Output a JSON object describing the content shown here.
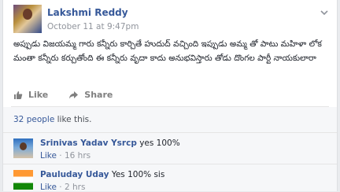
{
  "post": {
    "author": "Lakshmi Reddy",
    "timestamp": "October 11 at 9:47pm",
    "text": "అప్పుడు విజయమ్మ గారు కన్నీరు కార్చితే హుదుద్ వచ్చింది ఇప్పుడు అమ్మ తో పాటు మహిళా లోకమంతా కన్నీరు కర్చుతోంది ఈ కన్నీరు వృదా కాదు అనుభవిస్తారు తోడు దొంగల పార్టీ నాయకులారా",
    "like_label": "Like",
    "share_label": "Share"
  },
  "likes": {
    "count_text": "32 people",
    "suffix": " like this."
  },
  "comments": [
    {
      "author": "Srinivas Yadav Ysrcp",
      "text": " yes 100%",
      "like_label": "Like",
      "time": "16 hrs"
    },
    {
      "author": "Pauluday Uday",
      "text": " Yes 100% sis",
      "like_label": "Like",
      "time": "2 hrs"
    }
  ],
  "icons": {
    "chevron": "chevron-down-icon",
    "like": "thumbs-up-icon",
    "share": "share-arrow-icon"
  },
  "colors": {
    "link": "#365899",
    "meta": "#90949c",
    "background": "#e9ebee"
  }
}
